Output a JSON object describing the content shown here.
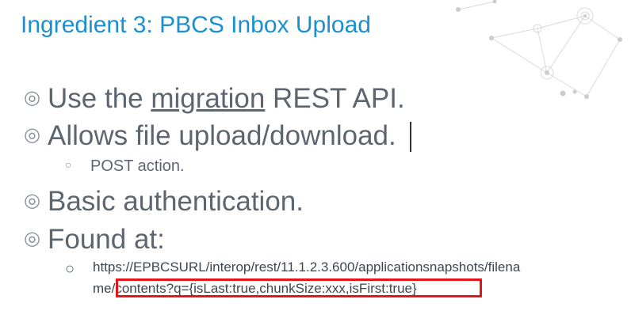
{
  "slide": {
    "title": "Ingredient 3: PBCS Inbox Upload",
    "bullet_glyph": "◎",
    "sub_bullet_glyph": "○",
    "bullets": [
      {
        "pre": "Use the ",
        "link": "migration",
        "post": " REST API."
      },
      {
        "text": "Allows file upload/download."
      },
      {
        "text": "POST action."
      },
      {
        "text": "Basic authentication."
      },
      {
        "text": "Found at:"
      }
    ],
    "url_line1": "https://EPBCSURL/interop/rest/11.1.2.3.600/applicationsnapshots/filena",
    "url_line2_pre": "me/",
    "url_line2_highlight": "contents?q={isLast:true,chunkSize:xxx,isFirst:true}"
  },
  "colors": {
    "title": "#1b8fd0",
    "body_text": "#5d6670",
    "highlight_border": "#e8141a"
  }
}
